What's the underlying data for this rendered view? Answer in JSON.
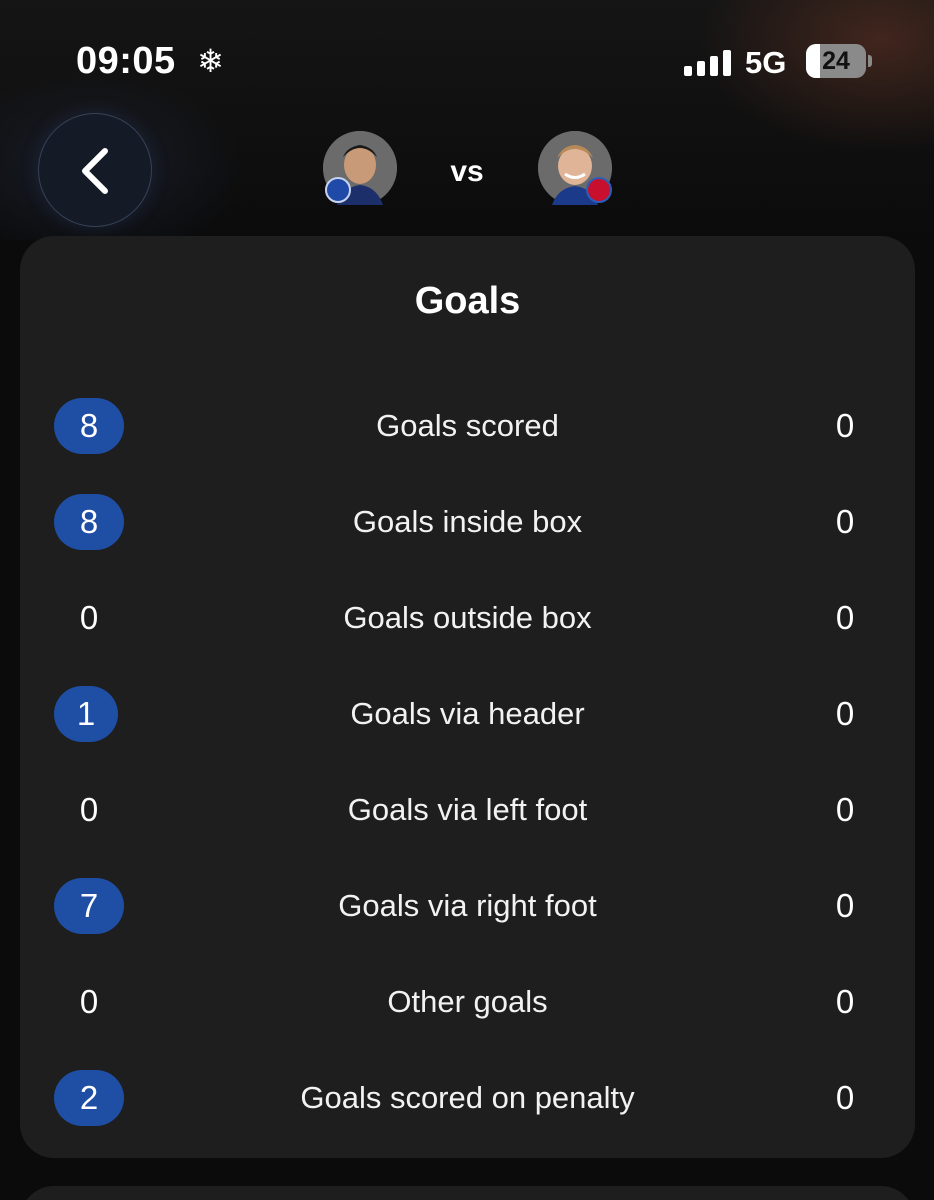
{
  "status_bar": {
    "time": "09:05",
    "network": "5G",
    "battery_level": "24",
    "battery_fraction": 0.24
  },
  "header": {
    "vs_label": "vs",
    "left_player_club_color": "#1f4aa8",
    "right_player_club_color": "#c8102e"
  },
  "card": {
    "title": "Goals",
    "highlight_color": "#1f4ea5",
    "rows": [
      {
        "left": "8",
        "label": "Goals scored",
        "right": "0",
        "highlight": true
      },
      {
        "left": "8",
        "label": "Goals inside box",
        "right": "0",
        "highlight": true
      },
      {
        "left": "0",
        "label": "Goals outside box",
        "right": "0",
        "highlight": false
      },
      {
        "left": "1",
        "label": "Goals via header",
        "right": "0",
        "highlight": true
      },
      {
        "left": "0",
        "label": "Goals via left foot",
        "right": "0",
        "highlight": false
      },
      {
        "left": "7",
        "label": "Goals via right foot",
        "right": "0",
        "highlight": true
      },
      {
        "left": "0",
        "label": "Other goals",
        "right": "0",
        "highlight": false
      },
      {
        "left": "2",
        "label": "Goals scored on penalty",
        "right": "0",
        "highlight": true
      }
    ]
  }
}
